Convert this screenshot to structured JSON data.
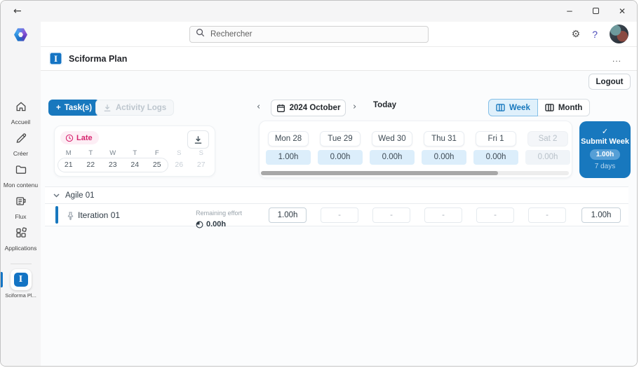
{
  "colors": {
    "primary": "#1878be",
    "late": "#d6246e",
    "day_value_bg": "#dceefb"
  },
  "titlebar": {
    "back_icon": "←",
    "minimize_icon": "−",
    "close_icon": "✕"
  },
  "sidebar": {
    "items": [
      {
        "label": "Accueil"
      },
      {
        "label": "Créer"
      },
      {
        "label": "Mon contenu"
      },
      {
        "label": "Flux"
      },
      {
        "label": "Applications"
      }
    ],
    "pinned_app": {
      "label": "Sciforma Pl...",
      "icon_letter": "I"
    }
  },
  "topbar": {
    "search_placeholder": "Rechercher",
    "help_icon": "?"
  },
  "app_header": {
    "title": "Sciforma Plan",
    "icon_letter": "I",
    "menu_icon": "..."
  },
  "actions": {
    "logout": "Logout",
    "add_task_plus": "+",
    "add_task": "Task(s)",
    "activity_logs": "Activity Logs"
  },
  "date_nav": {
    "prev_icon": "‹",
    "next_icon": "›",
    "period": "2024 October",
    "today": "Today"
  },
  "view_toggle": {
    "week": "Week",
    "month": "Month",
    "selected": "Week"
  },
  "late_card": {
    "badge": "Late",
    "day_headers": [
      "M",
      "T",
      "W",
      "T",
      "F",
      "S",
      "S"
    ],
    "dates": [
      "21",
      "22",
      "23",
      "24",
      "25",
      "26",
      "27"
    ]
  },
  "week_strip": {
    "days": [
      {
        "label": "Mon 28",
        "value": "1.00h"
      },
      {
        "label": "Tue 29",
        "value": "0.00h"
      },
      {
        "label": "Wed 30",
        "value": "0.00h"
      },
      {
        "label": "Thu 31",
        "value": "0.00h"
      },
      {
        "label": "Fri 1",
        "value": "0.00h"
      },
      {
        "label": "Sat 2",
        "value": "0.00h"
      }
    ]
  },
  "submit": {
    "check_icon": "✓",
    "label": "Submit Week",
    "hours": "1.00h",
    "duration": "7 days"
  },
  "group": {
    "label": "Agile 01"
  },
  "task_row": {
    "name": "Iteration 01",
    "remaining_label": "Remaining effort",
    "remaining_value": "0.00h",
    "cells": [
      "1.00h",
      "-",
      "-",
      "-",
      "-",
      "-"
    ],
    "total": "1.00h"
  }
}
